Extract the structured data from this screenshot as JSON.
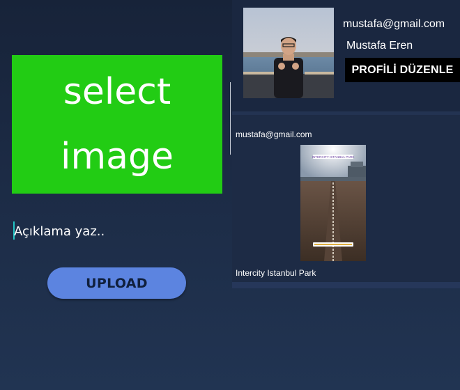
{
  "upload": {
    "select_image_label": "select\nimage",
    "description_placeholder": "Açıklama yaz..",
    "upload_button": "UPLOAD"
  },
  "profile": {
    "email": "mustafa@gmail.com",
    "name": "Mustafa Eren",
    "edit_button": "PROFİLİ DÜZENLE"
  },
  "posts": [
    {
      "email": "mustafa@gmail.com",
      "image_text": "INTERCITY ISTANBUL PARK",
      "caption": "Intercity Istanbul Park"
    }
  ],
  "colors": {
    "select_image_bg": "#22cc14",
    "upload_button_bg": "#5c84e0",
    "edit_button_bg": "#000000",
    "caret": "#22c6c6"
  }
}
